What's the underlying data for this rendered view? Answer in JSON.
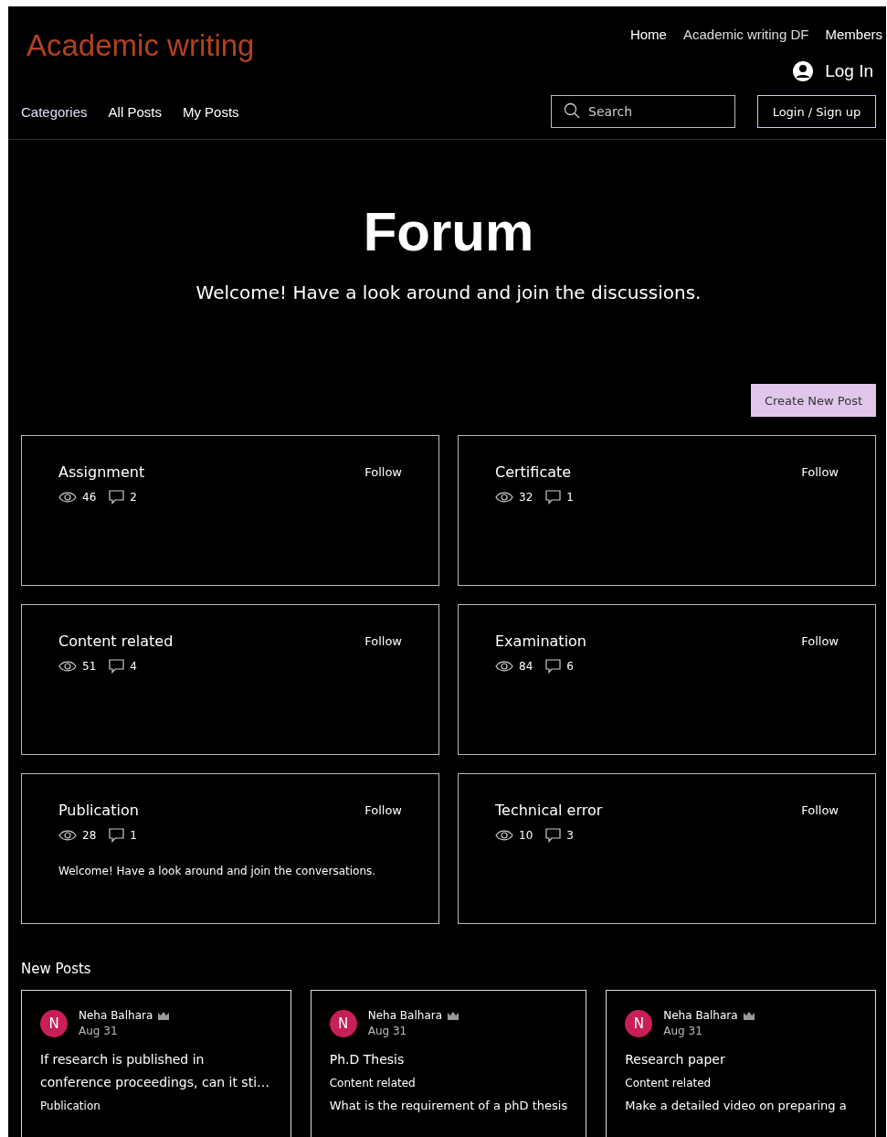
{
  "site": {
    "logo": "Academic writing",
    "nav": [
      "Home",
      "Academic writing DF",
      "Members"
    ],
    "login": "Log In"
  },
  "subnav": {
    "links": [
      "Categories",
      "All Posts",
      "My Posts"
    ],
    "search": {
      "placeholder": "Search"
    },
    "signup": "Login / Sign up"
  },
  "hero": {
    "title": "Forum",
    "subtitle": "Welcome! Have a look around and join the discussions."
  },
  "create_button": "Create New Post",
  "categories": [
    {
      "name": "Assignment",
      "follow": "Follow",
      "views": "46",
      "comments": "2"
    },
    {
      "name": "Certificate",
      "follow": "Follow",
      "views": "32",
      "comments": "1"
    },
    {
      "name": "Content related",
      "follow": "Follow",
      "views": "51",
      "comments": "4"
    },
    {
      "name": "Examination",
      "follow": "Follow",
      "views": "84",
      "comments": "6"
    },
    {
      "name": "Publication",
      "follow": "Follow",
      "views": "28",
      "comments": "1",
      "description": "Welcome! Have a look around and join the conversations."
    },
    {
      "name": "Technical error",
      "follow": "Follow",
      "views": "10",
      "comments": "3"
    }
  ],
  "new_posts": {
    "heading": "New Posts",
    "posts": [
      {
        "initial": "N",
        "author": "Neha Balhara",
        "admin": true,
        "date": "Aug 31",
        "title": "If research is published in conference proceedings, can it sti…",
        "category": "Publication"
      },
      {
        "initial": "N",
        "author": "Neha Balhara",
        "admin": true,
        "date": "Aug 31",
        "title": "Ph.D Thesis",
        "category": "Content related",
        "excerpt": "What is the requirement of a phD thesis"
      },
      {
        "initial": "N",
        "author": "Neha Balhara",
        "admin": true,
        "date": "Aug 31",
        "title": "Research paper",
        "category": "Content related",
        "excerpt": "Make a detailed video on preparing a"
      }
    ]
  }
}
